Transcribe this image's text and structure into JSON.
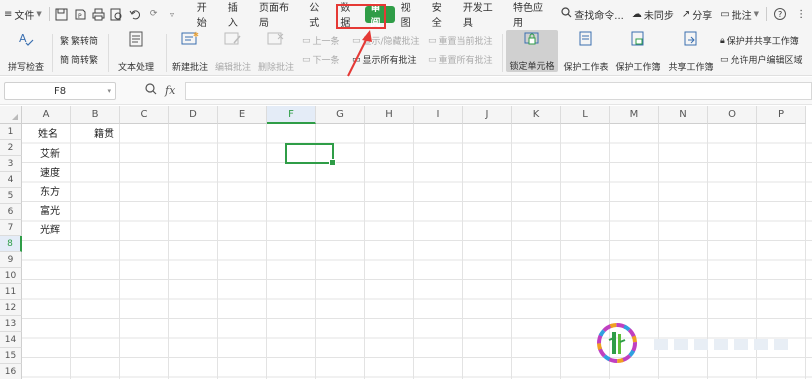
{
  "menubar": {
    "file_label": "文件",
    "tabs": [
      "开始",
      "插入",
      "页面布局",
      "公式",
      "数据",
      "审阅",
      "视图",
      "安全",
      "开发工具",
      "特色应用"
    ],
    "active_tab": "审阅",
    "search_label": "查找命令...",
    "sync_label": "未同步",
    "share_label": "分享",
    "comment_label": "批注",
    "help_label": "?"
  },
  "ribbon": {
    "spellcheck": "拼写检查",
    "to_traditional": "繁转简",
    "to_simplified": "简转繁",
    "text_process": "文本处理",
    "new_comment": "新建批注",
    "edit_comment": "编辑批注",
    "delete_comment": "删除批注",
    "prev": "上一条",
    "next": "下一条",
    "show_hide_comment": "显示/隐藏批注",
    "show_all_comments": "显示所有批注",
    "reset_current_comment": "重置当前批注",
    "reset_all_comments": "重置所有批注",
    "lock_cell": "锁定单元格",
    "protect_sheet": "保护工作表",
    "protect_workbook": "保护工作簿",
    "share_workbook": "共享工作簿",
    "protect_and_share": "保护并共享工作簿",
    "allow_user_edit": "允许用户编辑区域"
  },
  "formula_bar": {
    "name_box": "F8",
    "fx_label": "fx",
    "value": ""
  },
  "sheet": {
    "columns": [
      "A",
      "B",
      "C",
      "D",
      "E",
      "F",
      "G",
      "H",
      "I",
      "J",
      "K",
      "L",
      "M",
      "N",
      "O",
      "P"
    ],
    "rows": [
      "1",
      "2",
      "3",
      "4",
      "5",
      "6",
      "7",
      "8",
      "9",
      "10",
      "11",
      "12",
      "13",
      "14",
      "15",
      "16"
    ],
    "selected_col": "F",
    "selected_row": "8",
    "header_a1": "姓名",
    "header_b1": "籍贯",
    "names": [
      "艾新",
      "速度",
      "东方",
      "富光",
      "光辉"
    ]
  },
  "colors": {
    "accent": "#2f9d47",
    "annotation_red": "#e53935"
  }
}
